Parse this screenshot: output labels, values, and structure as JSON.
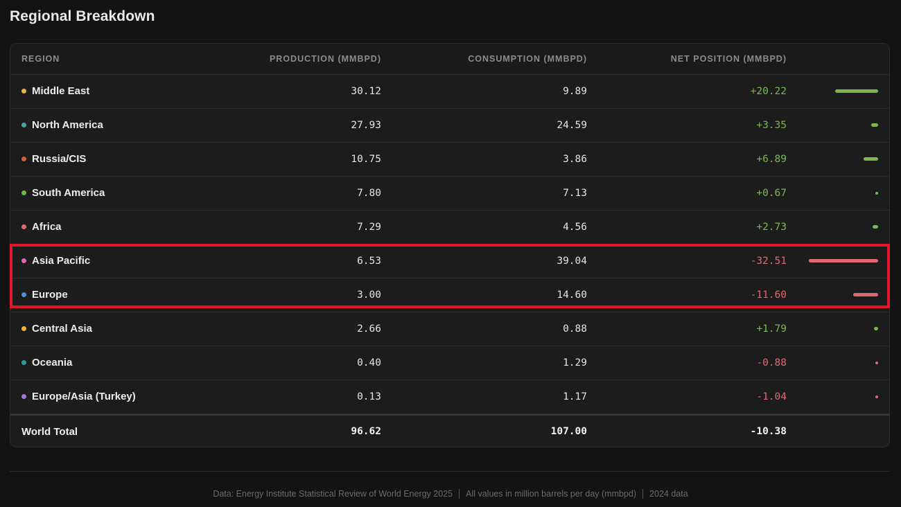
{
  "section": {
    "title": "Regional Breakdown"
  },
  "table": {
    "headers": {
      "region": "REGION",
      "production": "PRODUCTION (MMBPD)",
      "consumption": "CONSUMPTION (MMBPD)",
      "net": "NET POSITION (MMBPD)"
    },
    "rows": [
      {
        "region": "Middle East",
        "dot_color": "#f0b14a",
        "production": "30.12",
        "consumption": "9.89",
        "net": "+20.22",
        "net_value": 20.22
      },
      {
        "region": "North America",
        "dot_color": "#4fa3a8",
        "production": "27.93",
        "consumption": "24.59",
        "net": "+3.35",
        "net_value": 3.35
      },
      {
        "region": "Russia/CIS",
        "dot_color": "#c8643c",
        "production": "10.75",
        "consumption": "3.86",
        "net": "+6.89",
        "net_value": 6.89
      },
      {
        "region": "South America",
        "dot_color": "#6cbb3c",
        "production": "7.80",
        "consumption": "7.13",
        "net": "+0.67",
        "net_value": 0.67
      },
      {
        "region": "Africa",
        "dot_color": "#e06a74",
        "production": "7.29",
        "consumption": "4.56",
        "net": "+2.73",
        "net_value": 2.73
      },
      {
        "region": "Asia Pacific",
        "dot_color": "#e06aa8",
        "production": "6.53",
        "consumption": "39.04",
        "net": "-32.51",
        "net_value": -32.51
      },
      {
        "region": "Europe",
        "dot_color": "#4f8fd0",
        "production": "3.00",
        "consumption": "14.60",
        "net": "-11.60",
        "net_value": -11.6
      },
      {
        "region": "Central Asia",
        "dot_color": "#f0b830",
        "production": "2.66",
        "consumption": "0.88",
        "net": "+1.79",
        "net_value": 1.79
      },
      {
        "region": "Oceania",
        "dot_color": "#2a9aa0",
        "production": "0.40",
        "consumption": "1.29",
        "net": "-0.88",
        "net_value": -0.88
      },
      {
        "region": "Europe/Asia (Turkey)",
        "dot_color": "#a974e0",
        "production": "0.13",
        "consumption": "1.17",
        "net": "-1.04",
        "net_value": -1.04
      }
    ],
    "total": {
      "label": "World Total",
      "production": "96.62",
      "consumption": "107.00",
      "net": "-10.38"
    }
  },
  "colors": {
    "positive": "#7cb84f",
    "negative": "#e06a74",
    "highlight": "#e0182d"
  },
  "footer": {
    "source": "Data: Energy Institute Statistical Review of World Energy 2025",
    "units": "All values in million barrels per day (mmbpd)",
    "year": "2024 data"
  }
}
